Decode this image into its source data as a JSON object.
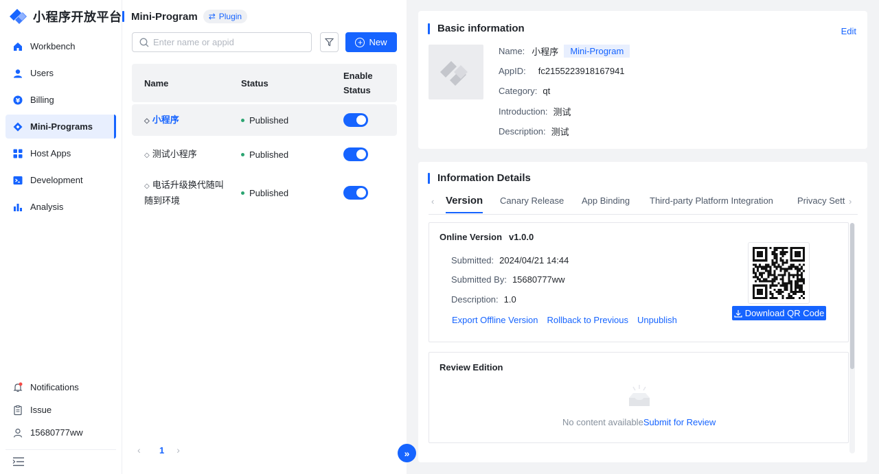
{
  "brand": {
    "name": "小程序开放平台"
  },
  "nav": [
    {
      "label": "Workbench",
      "icon": "home-icon"
    },
    {
      "label": "Users",
      "icon": "user-icon"
    },
    {
      "label": "Billing",
      "icon": "yen-icon"
    },
    {
      "label": "Mini-Programs",
      "icon": "diamond-icon",
      "active": true
    },
    {
      "label": "Host Apps",
      "icon": "grid-icon"
    },
    {
      "label": "Development",
      "icon": "terminal-icon"
    },
    {
      "label": "Analysis",
      "icon": "bar-chart-icon"
    }
  ],
  "side_bottom": {
    "notifications": "Notifications",
    "issue": "Issue",
    "user": "15680777ww"
  },
  "list": {
    "title": "Mini-Program",
    "plugin_label": "Plugin",
    "search_placeholder": "Enter name or appid",
    "new_label": "New",
    "columns": {
      "name": "Name",
      "status": "Status",
      "enable": "Enable",
      "enable2": "Status"
    },
    "rows": [
      {
        "name": "小程序",
        "status": "Published",
        "enabled": true,
        "selected": true
      },
      {
        "name": "测试小程序",
        "status": "Published",
        "enabled": true
      },
      {
        "name": "电话升级换代随叫随到环境",
        "name_line1": "电话升级换代随叫",
        "name_line2": "随到环境",
        "status": "Published",
        "enabled": true
      }
    ],
    "page": "1"
  },
  "basic": {
    "title": "Basic information",
    "edit": "Edit",
    "name_label": "Name:",
    "name_value": "小程序",
    "name_tag": "Mini-Program",
    "appid_label": "AppID:",
    "appid_value": "fc2155223918167941",
    "category_label": "Category:",
    "category_value": "qt",
    "intro_label": "Introduction:",
    "intro_value": "测试",
    "desc_label": "Description:",
    "desc_value": "测试"
  },
  "details": {
    "title": "Information Details",
    "tabs": [
      "Version",
      "Canary Release",
      "App Binding",
      "Third-party Platform Integration",
      "Privacy Sett"
    ],
    "online": {
      "title": "Online Version",
      "version": "v1.0.0",
      "submitted_label": "Submitted:",
      "submitted_value": "2024/04/21 14:44",
      "by_label": "Submitted By:",
      "by_value": "15680777ww",
      "desc_label": "Description:",
      "desc_value": "1.0",
      "links": [
        "Export Offline Version",
        "Rollback to Previous",
        "Unpublish"
      ],
      "download": "Download QR Code"
    },
    "review": {
      "title": "Review Edition",
      "empty": "No content available",
      "submit": "Submit for Review"
    }
  },
  "colors": {
    "accent": "#1664ff",
    "success": "#2ba471",
    "bg": "#f2f3f5"
  }
}
